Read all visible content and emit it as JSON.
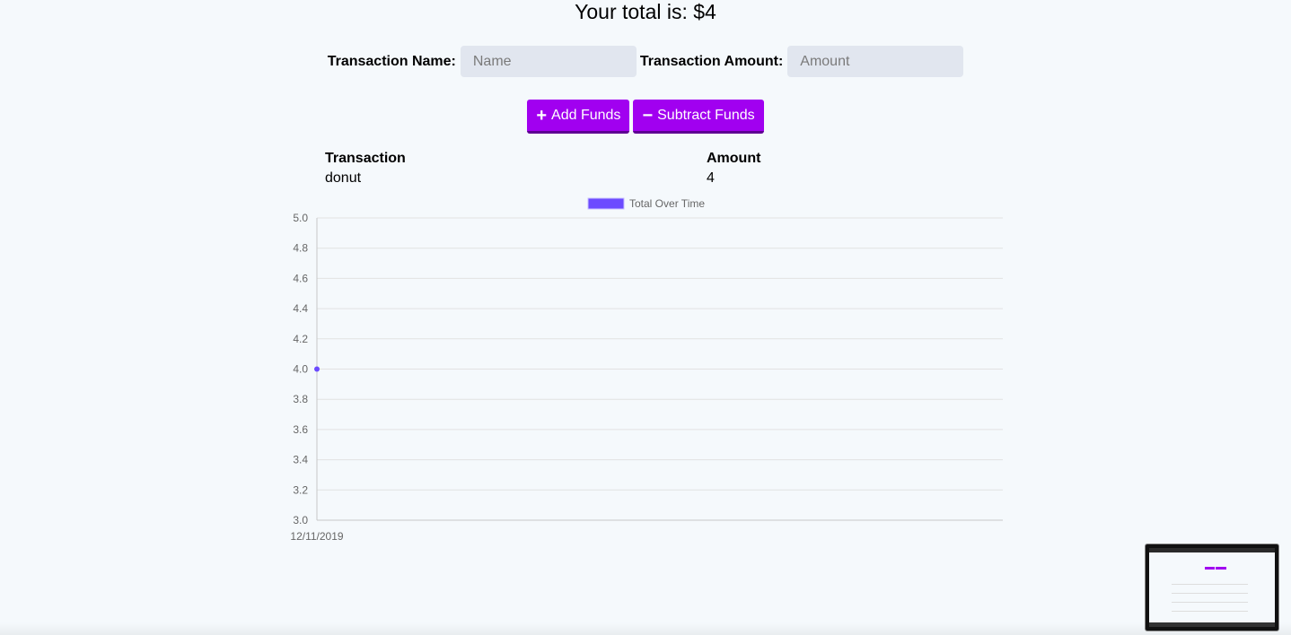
{
  "header": {
    "total_text": "Your total is: $4"
  },
  "form": {
    "name_label": "Transaction Name:",
    "name_placeholder": "Name",
    "amount_label": "Transaction Amount:",
    "amount_placeholder": "Amount"
  },
  "buttons": {
    "add_label": "Add Funds",
    "add_icon": "plus-icon",
    "subtract_label": "Subtract Funds",
    "subtract_icon": "minus-icon"
  },
  "table": {
    "headers": [
      "Transaction",
      "Amount"
    ],
    "rows": [
      {
        "name": "donut",
        "amount": "4"
      }
    ]
  },
  "colors": {
    "button": "#a100f0",
    "series": "#6c4bff",
    "background": "#f5f9fc"
  },
  "chart_data": {
    "type": "line",
    "x": [
      "12/11/2019"
    ],
    "series": [
      {
        "name": "Total Over Time",
        "values": [
          4
        ]
      }
    ],
    "ylim": [
      3.0,
      5.0
    ],
    "yticks": [
      "5.0",
      "4.8",
      "4.6",
      "4.4",
      "4.2",
      "4.0",
      "3.8",
      "3.6",
      "3.4",
      "3.2",
      "3.0"
    ],
    "grid": true,
    "legend": "top-center"
  }
}
